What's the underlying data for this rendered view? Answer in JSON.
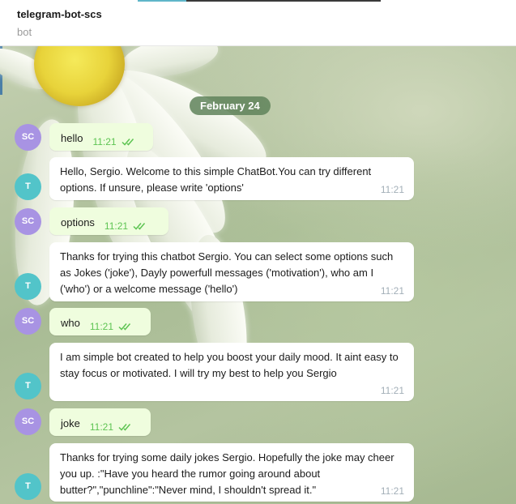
{
  "header": {
    "title": "telegram-bot-scs",
    "subtitle": "bot"
  },
  "date_separator": "February 24",
  "colors": {
    "outgoing_bubble": "#effdde",
    "incoming_bubble": "#ffffff",
    "user_avatar": "#a893e3",
    "bot_avatar": "#52c4c9",
    "read_time": "#5dc452"
  },
  "messages": [
    {
      "sender": "user",
      "avatar": "SC",
      "text": "hello",
      "time": "11:21",
      "status": "read"
    },
    {
      "sender": "bot",
      "avatar": "T",
      "text": "Hello, Sergio. Welcome to this simple ChatBot.You can try different options. If unsure, please write 'options'",
      "time": "11:21"
    },
    {
      "sender": "user",
      "avatar": "SC",
      "text": "options",
      "time": "11:21",
      "status": "read"
    },
    {
      "sender": "bot",
      "avatar": "T",
      "text": "Thanks for trying this chatbot Sergio. You can select some options such as Jokes ('joke'), Dayly powerfull messages ('motivation'), who am I ('who') or a welcome message ('hello')",
      "time": "11:21"
    },
    {
      "sender": "user",
      "avatar": "SC",
      "text": "who",
      "time": "11:21",
      "status": "read"
    },
    {
      "sender": "bot",
      "avatar": "T",
      "text": "I am simple bot created to help you boost your daily mood. It aint easy to stay focus or motivated. I will try my best to help you Sergio",
      "time": "11:21"
    },
    {
      "sender": "user",
      "avatar": "SC",
      "text": "joke",
      "time": "11:21",
      "status": "read"
    },
    {
      "sender": "bot",
      "avatar": "T",
      "text": "Thanks for trying some daily jokes Sergio. Hopefully the joke may cheer you up. :\"Have you heard the rumor going around about butter?\",\"punchline\":\"Never mind, I shouldn't spread it.\"",
      "time": "11:21"
    }
  ]
}
